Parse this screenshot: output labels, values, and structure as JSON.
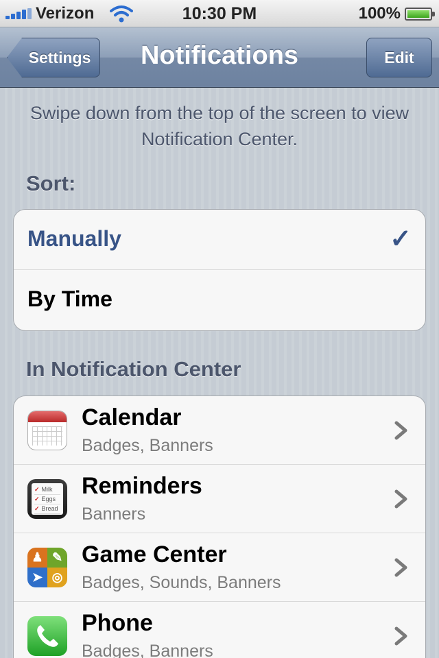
{
  "status_bar": {
    "carrier": "Verizon",
    "time": "10:30 PM",
    "battery": "100%"
  },
  "nav": {
    "back_label": "Settings",
    "title": "Notifications",
    "edit_label": "Edit"
  },
  "hint": "Swipe down from the top of the screen to view Notification Center.",
  "sort": {
    "header": "Sort:",
    "options": [
      {
        "label": "Manually",
        "selected": true
      },
      {
        "label": "By Time",
        "selected": false
      }
    ]
  },
  "notification_center": {
    "header": "In Notification Center",
    "apps": [
      {
        "name": "Calendar",
        "detail": "Badges, Banners",
        "icon": "calendar-icon"
      },
      {
        "name": "Reminders",
        "detail": "Banners",
        "icon": "reminders-icon"
      },
      {
        "name": "Game Center",
        "detail": "Badges, Sounds, Banners",
        "icon": "game-center-icon"
      },
      {
        "name": "Phone",
        "detail": "Badges, Banners",
        "icon": "phone-icon"
      }
    ],
    "reminders_icon_text": [
      "Milk",
      "Eggs",
      "Bread"
    ]
  },
  "colors": {
    "nav_bar": "#6d82a0",
    "selected_text": "#385487",
    "background": "#c5ccd4"
  }
}
